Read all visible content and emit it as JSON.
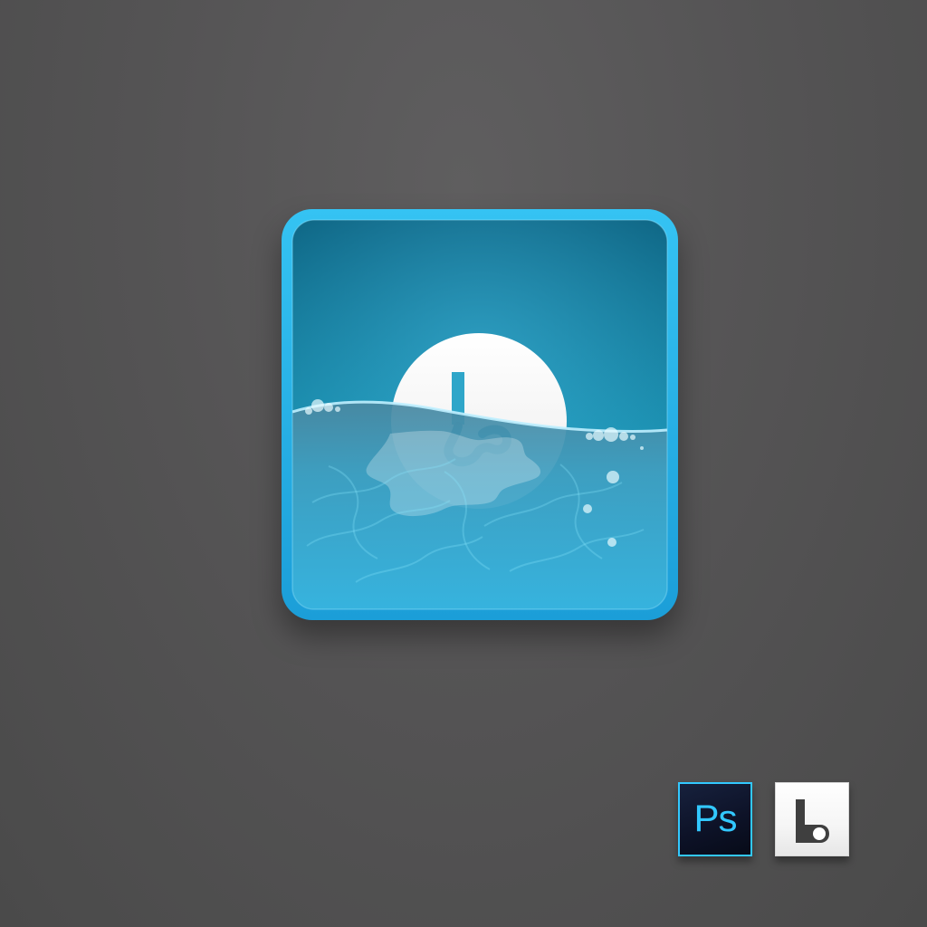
{
  "colors": {
    "page_background": "#555455",
    "icon_border": "#22aee6",
    "water_light": "#38b8df",
    "water_dark": "#0e6e8c",
    "ps_accent": "#32c8ff",
    "ps_background": "#0d1227"
  },
  "main_icon": {
    "icon_name": "snorkel-mask-icon"
  },
  "brand_badges": {
    "photoshop_label": "Ps",
    "photoshop_icon": "photoshop-icon",
    "letter_icon": "letter-l-icon"
  }
}
